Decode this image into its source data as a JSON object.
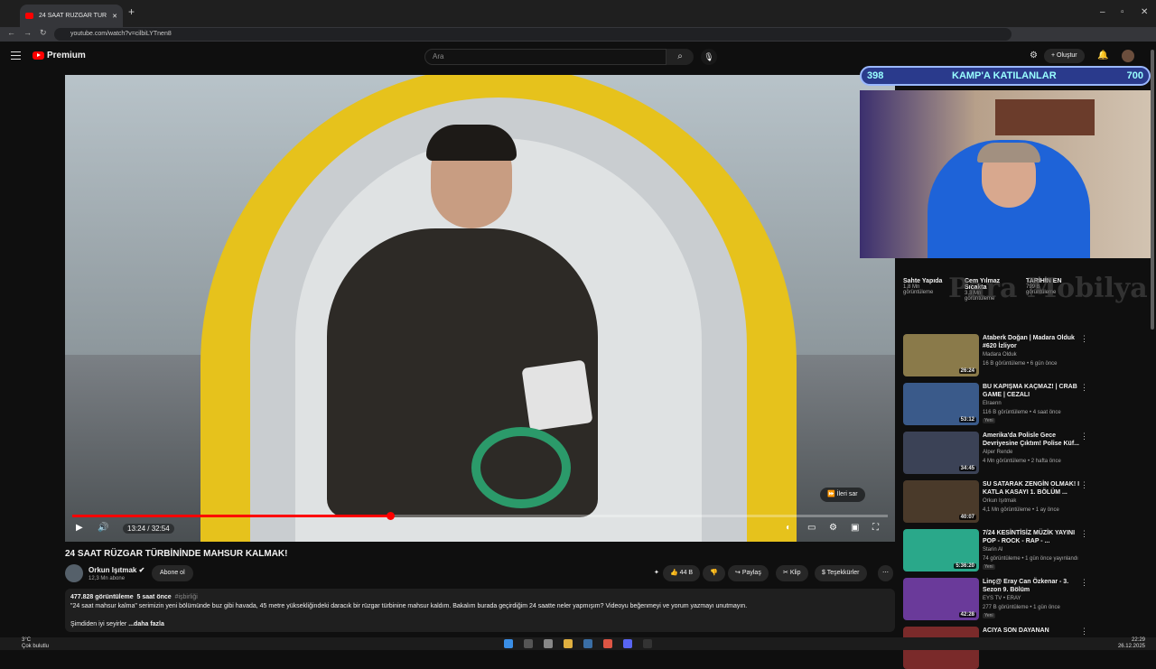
{
  "browser": {
    "tab_title": "24 SAAT RÜZGAR TÜRBİNİNDE",
    "url": "youtube.com/watch?v=cilbiLYTnen8"
  },
  "header": {
    "brand": "Premium",
    "search_placeholder": "Ara",
    "create_label": "Oluştur"
  },
  "player": {
    "time": "13:24 / 32:54",
    "skip_label": "İleri sar",
    "progress_fraction": 0.39
  },
  "video": {
    "title": "24 SAAT RÜZGAR TÜRBİNİNDE MAHSUR KALMAK!",
    "channel": "Orkun Işıtmak",
    "subscribers": "12,3 Mn abone",
    "subscribe_label": "Abone ol",
    "likes": "44 B",
    "share_label": "Paylaş",
    "clip_label": "Klip",
    "thanks_label": "Teşekkürler"
  },
  "description": {
    "views": "477.828 görüntüleme",
    "time_ago": "5 saat önce",
    "tag": "#işbirliği",
    "text": "\"24 saat mahsur kalma\" serimizin yeni bölümünde buz gibi havada, 45 metre yüksekliğindeki daracık bir rüzgar türbinine mahsur kaldım. Bakalım burada geçirdiğim 24 saatte neler yapmışım? Videoyu beğenmeyi ve yorum yazmayı unutmayın.",
    "signoff": "Şimdiden iyi seyirler",
    "more_label": "...daha fazla"
  },
  "overlay": {
    "left_count": "398",
    "center_text": "KAMP'A KATILANLAR",
    "right_count": "700",
    "watermark": "Para Mobilya"
  },
  "mini_videos": [
    {
      "title": "Sahte Yapıda",
      "views": "1,8 Mn",
      "meta": "görüntüleme"
    },
    {
      "title": "Cem Yılmaz Sıcakta",
      "views": "3,3 Mn",
      "meta": "görüntüleme"
    },
    {
      "title": "TARİHİN EN",
      "views": "799 B",
      "meta": "görüntüleme"
    }
  ],
  "sidebar": [
    {
      "title": "Ataberk Doğan | Madara Olduk #620 İzliyor",
      "channel": "Madara Olduk",
      "meta": "16 B görüntüleme • 6 gün önce",
      "duration": "26:24",
      "badge": "",
      "color": "#8a7a4a"
    },
    {
      "title": "BU KAPIŞMA KAÇMAZ! | CRAB GAME | CEZALI",
      "channel": "Elraenn",
      "meta": "116 B görüntüleme • 4 saat önce",
      "duration": "53:12",
      "badge": "Yeni",
      "color": "#3a5a8a"
    },
    {
      "title": "Amerika'da Polisle Gece Devriyesine Çıktım! Polise Küf...",
      "channel": "Alper Rende",
      "meta": "4 Mn görüntüleme • 2 hafta önce",
      "duration": "34:45",
      "badge": "",
      "color": "#3b4256"
    },
    {
      "title": "SU SATARAK ZENGİN OLMAK! I KATLA KASAYI 1. BÖLÜM ...",
      "channel": "Orkun Işıtmak",
      "meta": "4,1 Mn görüntüleme • 1 ay önce",
      "duration": "40:07",
      "badge": "",
      "color": "#4a3a2a"
    },
    {
      "title": "7/24 KESİNTİSİZ MÜZİK YAYINI POP - ROCK - RAP - ...",
      "channel": "Starin Al",
      "meta": "74 görüntüleme • 1 gün önce yayınlandı",
      "duration": "5:36:20",
      "badge": "Yeni",
      "color": "#2aa88a"
    },
    {
      "title": "Linç@ Eray Can Özkenar - 3. Sezon 9. Bölüm",
      "channel": "EYS TV • ERAY",
      "meta": "277 B görüntüleme • 1 gün önce",
      "duration": "42:28",
      "badge": "Yeni",
      "color": "#6a3a9a"
    },
    {
      "title": "ACIYA SON DAYANAN",
      "channel": "",
      "meta": "",
      "duration": "",
      "badge": "",
      "color": "#7a2a2a"
    }
  ],
  "taskbar": {
    "weather": "3°C",
    "weather_desc": "Çok bulutlu",
    "time": "22:29",
    "date": "26.12.2025"
  }
}
